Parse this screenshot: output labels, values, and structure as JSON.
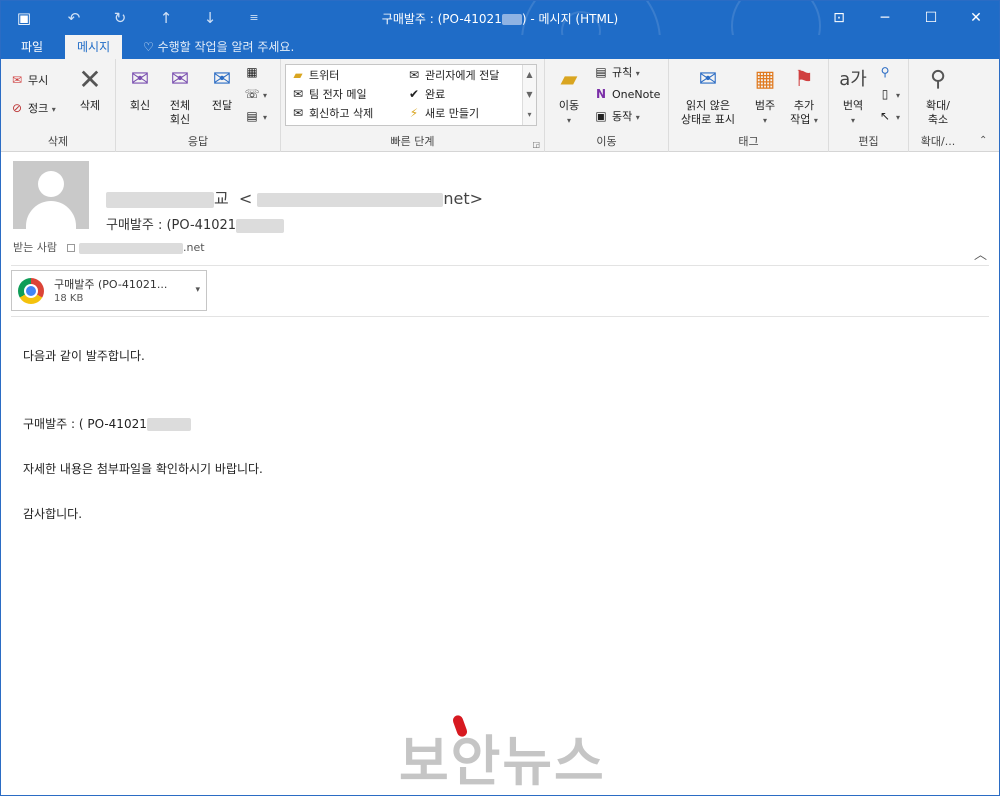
{
  "window": {
    "title": "구매발주 : (PO-41021",
    "title_suffix": ") - 메시지 (HTML)",
    "controls": [
      "⊡",
      "─",
      "☐",
      "✕"
    ]
  },
  "quick_access": {
    "icons": [
      "save-icon",
      "undo-icon",
      "redo-icon",
      "up-icon",
      "down-icon",
      "customize-icon"
    ]
  },
  "tabs": [
    {
      "label": "파일",
      "active": false
    },
    {
      "label": "메시지",
      "active": true
    }
  ],
  "tell_me": "수행할 작업을 알려 주세요.",
  "ribbon": {
    "delete_group": {
      "label": "삭제",
      "ignore": "무시",
      "junk": "정크",
      "delete": "삭제"
    },
    "respond_group": {
      "label": "응답",
      "reply": "회신",
      "reply_all_1": "전체",
      "reply_all_2": "회신",
      "forward": "전달"
    },
    "quick_steps_group": {
      "label": "빠른 단계",
      "items": [
        "트위터",
        "관리자에게 전달",
        "팀 전자 메일",
        "완료",
        "회신하고 삭제",
        "새로 만들기"
      ]
    },
    "move_group": {
      "label": "이동",
      "move": "이동",
      "rules": "규칙",
      "onenote": "OneNote",
      "actions": "동작"
    },
    "tags_group": {
      "label": "태그",
      "mark_unread_1": "읽지 않은",
      "mark_unread_2": "상태로 표시",
      "categorize": "범주",
      "followup_1": "추가",
      "followup_2": "작업"
    },
    "editing_group": {
      "label": "편집",
      "translate": "번역"
    },
    "zoom_group": {
      "label": "확대/...",
      "zoom_1": "확대/",
      "zoom_2": "축소"
    }
  },
  "message": {
    "sender_name_suffix": "교",
    "sender_email_prefix": "<",
    "sender_email_suffix": "net>",
    "subject": "구매발주 : (PO-41021",
    "to_label": "받는 사람",
    "to_suffix": ".net",
    "attachment": {
      "name": "구매발주  (PO-41021...",
      "size": "18 KB"
    },
    "body_lines": [
      "다음과 같이 발주합니다.",
      "구매발주 : ( PO-41021",
      "자세한 내용은 첨부파일을 확인하시기 바랍니다.",
      "감사합니다."
    ]
  },
  "watermark": "보안뉴스"
}
